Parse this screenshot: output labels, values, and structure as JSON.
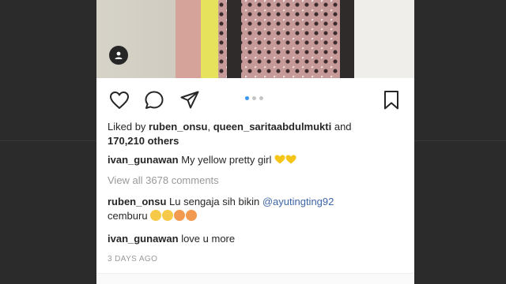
{
  "post": {
    "likes": {
      "prefix": "Liked by ",
      "user1": "ruben_onsu",
      "sep": ", ",
      "user2": "queen_saritaabdulmukti",
      "and": " and",
      "others": "170,210 others"
    },
    "caption": {
      "username": "ivan_gunawan",
      "text": " My yellow pretty girl ",
      "emojis": [
        "yellow-heart",
        "yellow-heart"
      ]
    },
    "view_all_comments": "View all 3678 comments",
    "comments": [
      {
        "username": "ruben_onsu",
        "text": " Lu sengaja sih bikin ",
        "mention": "@ayutingting92",
        "text2": "cemburu ",
        "emojis": [
          "rolling-laugh-face",
          "rolling-laugh-face",
          "flushed-face",
          "flushed-face"
        ]
      },
      {
        "username": "ivan_gunawan",
        "text": " love u more"
      }
    ],
    "timestamp": "3 DAYS AGO",
    "carousel": {
      "count": 3,
      "active": 0
    }
  },
  "icons": {
    "user_tag": "person-icon",
    "like": "heart-icon",
    "comment": "comment-icon",
    "share": "send-icon",
    "save": "bookmark-icon"
  },
  "colors": {
    "accent": "#3897f0",
    "mention": "#3f66a8",
    "text": "#262626",
    "muted": "#999999",
    "background": "#2b2b2b"
  }
}
